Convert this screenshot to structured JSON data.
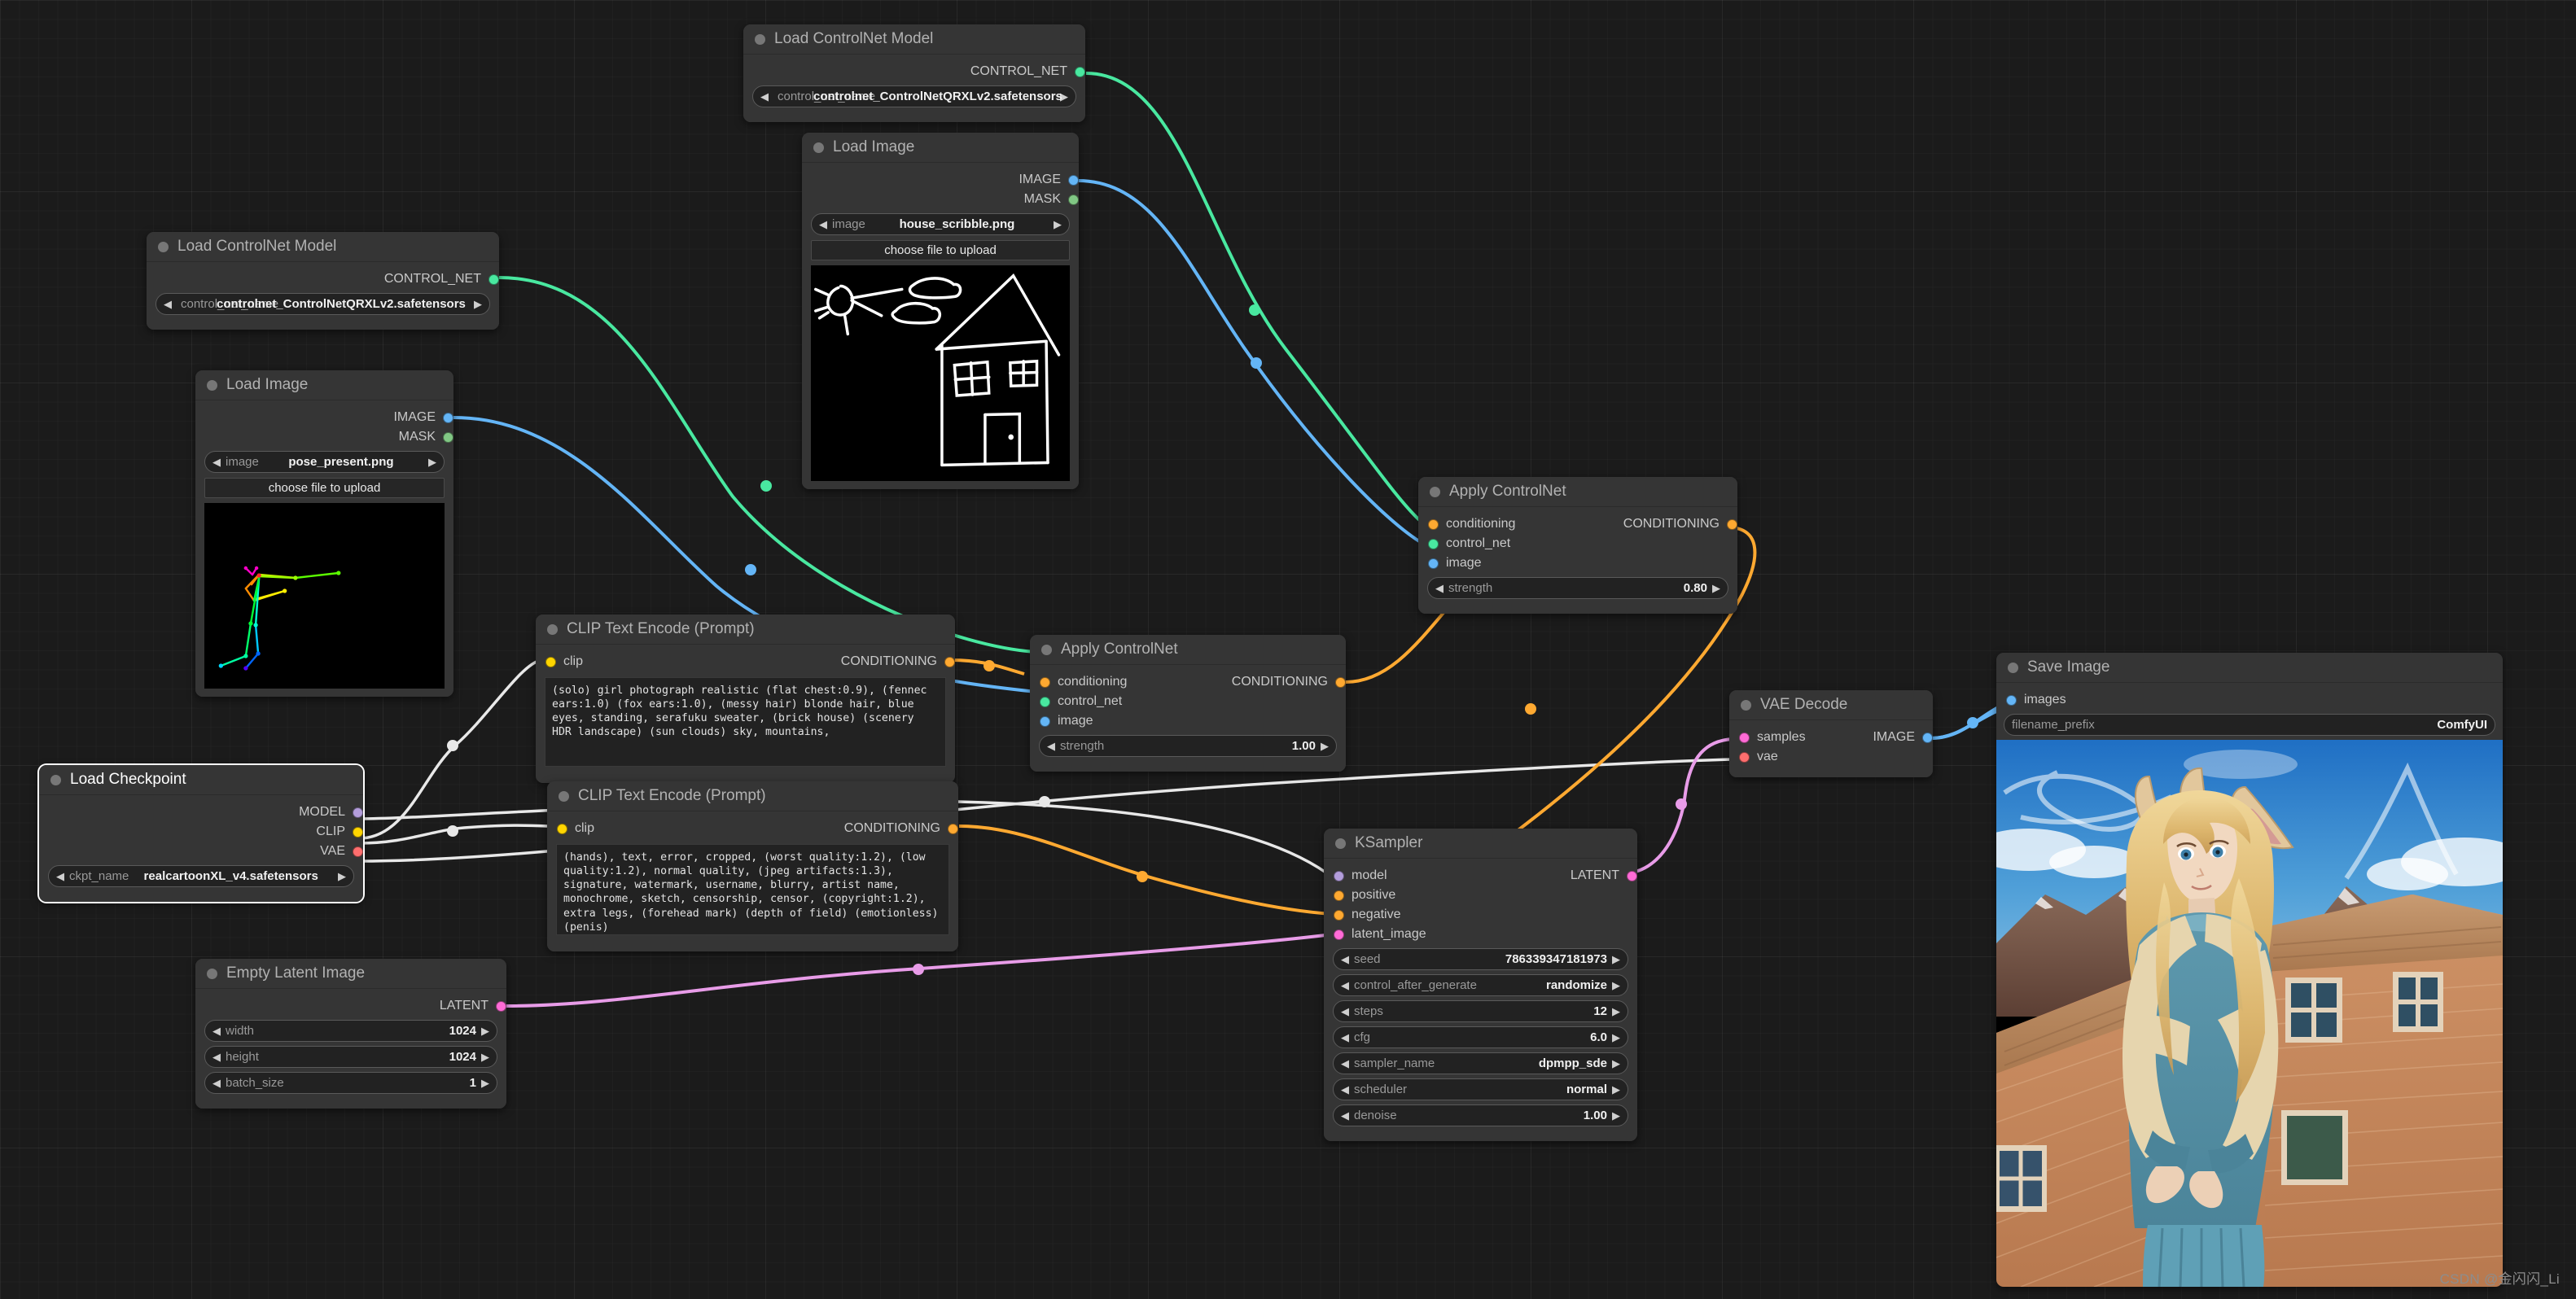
{
  "canvas": {
    "watermark": "CSDN @金闪闪_Li"
  },
  "nodes": {
    "load_controlnet_top": {
      "title": "Load ControlNet Model",
      "outputs": [
        {
          "label": "CONTROL_NET",
          "color": "#49e8a0"
        }
      ],
      "widget": {
        "label": "control_net_name",
        "value": "controlnet_ControlNetQRXLv2.safetensors",
        "arrow_left": "◀",
        "arrow_right": "▶"
      }
    },
    "load_image_top": {
      "title": "Load Image",
      "outputs": [
        {
          "label": "IMAGE",
          "color": "#64b5f6"
        },
        {
          "label": "MASK",
          "color": "#81c784"
        }
      ],
      "widget": {
        "label": "image",
        "value": "house_scribble.png",
        "arrow_left": "◀",
        "arrow_right": "▶"
      },
      "upload_button": "choose file to upload",
      "preview_alt": "house scribble line drawing: sun, two clouds, house with pitched roof, two windows and a door"
    },
    "load_controlnet_left": {
      "title": "Load ControlNet Model",
      "outputs": [
        {
          "label": "CONTROL_NET",
          "color": "#49e8a0"
        }
      ],
      "widget": {
        "label": "control_net_name",
        "value": "controlnet_ControlNetQRXLv2.safetensors",
        "arrow_left": "◀",
        "arrow_right": "▶"
      }
    },
    "load_image_left": {
      "title": "Load Image",
      "outputs": [
        {
          "label": "IMAGE",
          "color": "#64b5f6"
        },
        {
          "label": "MASK",
          "color": "#81c784"
        }
      ],
      "widget": {
        "label": "image",
        "value": "pose_present.png",
        "arrow_left": "◀",
        "arrow_right": "▶"
      },
      "upload_button": "choose file to upload",
      "preview_alt": "OpenPose skeleton of a standing figure on black background"
    },
    "clip_positive": {
      "title": "CLIP Text Encode (Prompt)",
      "inputs": [
        {
          "label": "clip",
          "color": "#ffd500"
        }
      ],
      "outputs": [
        {
          "label": "CONDITIONING",
          "color": "#ffa931"
        }
      ],
      "text": "(solo) girl photograph realistic (flat chest:0.9), (fennec ears:1.0) (fox ears:1.0), (messy hair) blonde hair, blue eyes, standing, serafuku sweater, (brick house) (scenery HDR landscape) (sun clouds) sky, mountains,"
    },
    "clip_negative": {
      "title": "CLIP Text Encode (Prompt)",
      "inputs": [
        {
          "label": "clip",
          "color": "#ffd500"
        }
      ],
      "outputs": [
        {
          "label": "CONDITIONING",
          "color": "#ffa931"
        }
      ],
      "text": "(hands), text, error, cropped, (worst quality:1.2), (low quality:1.2), normal quality, (jpeg artifacts:1.3), signature, watermark, username, blurry, artist name, monochrome, sketch, censorship, censor, (copyright:1.2), extra legs, (forehead mark) (depth of field) (emotionless) (penis)"
    },
    "apply_controlnet_1": {
      "title": "Apply ControlNet",
      "inputs": [
        {
          "label": "conditioning",
          "color": "#ffa931"
        },
        {
          "label": "control_net",
          "color": "#49e8a0"
        },
        {
          "label": "image",
          "color": "#64b5f6"
        }
      ],
      "outputs": [
        {
          "label": "CONDITIONING",
          "color": "#ffa931"
        }
      ],
      "widget": {
        "label": "strength",
        "value": "1.00",
        "arrow_left": "◀",
        "arrow_right": "▶"
      }
    },
    "apply_controlnet_2": {
      "title": "Apply ControlNet",
      "inputs": [
        {
          "label": "conditioning",
          "color": "#ffa931"
        },
        {
          "label": "control_net",
          "color": "#49e8a0"
        },
        {
          "label": "image",
          "color": "#64b5f6"
        }
      ],
      "outputs": [
        {
          "label": "CONDITIONING",
          "color": "#ffa931"
        }
      ],
      "widget": {
        "label": "strength",
        "value": "0.80",
        "arrow_left": "◀",
        "arrow_right": "▶"
      }
    },
    "load_checkpoint": {
      "title": "Load Checkpoint",
      "selected": true,
      "outputs": [
        {
          "label": "MODEL",
          "color": "#b39ddb"
        },
        {
          "label": "CLIP",
          "color": "#ffd500"
        },
        {
          "label": "VAE",
          "color": "#ff6e6e"
        }
      ],
      "widget": {
        "label": "ckpt_name",
        "value": "realcartoonXL_v4.safetensors",
        "arrow_left": "◀",
        "arrow_right": "▶"
      }
    },
    "empty_latent": {
      "title": "Empty Latent Image",
      "outputs": [
        {
          "label": "LATENT",
          "color": "#ff6bd6"
        }
      ],
      "widgets": [
        {
          "label": "width",
          "value": "1024",
          "arrow_left": "◀",
          "arrow_right": "▶"
        },
        {
          "label": "height",
          "value": "1024",
          "arrow_left": "◀",
          "arrow_right": "▶"
        },
        {
          "label": "batch_size",
          "value": "1",
          "arrow_left": "◀",
          "arrow_right": "▶"
        }
      ]
    },
    "ksampler": {
      "title": "KSampler",
      "inputs": [
        {
          "label": "model",
          "color": "#b39ddb"
        },
        {
          "label": "positive",
          "color": "#ffa931"
        },
        {
          "label": "negative",
          "color": "#ffa931"
        },
        {
          "label": "latent_image",
          "color": "#ff6bd6"
        }
      ],
      "outputs": [
        {
          "label": "LATENT",
          "color": "#ff6bd6"
        }
      ],
      "widgets": [
        {
          "label": "seed",
          "value": "786339347181973",
          "arrow_left": "◀",
          "arrow_right": "▶"
        },
        {
          "label": "control_after_generate",
          "value": "randomize",
          "arrow_left": "◀",
          "arrow_right": "▶"
        },
        {
          "label": "steps",
          "value": "12",
          "arrow_left": "◀",
          "arrow_right": "▶"
        },
        {
          "label": "cfg",
          "value": "6.0",
          "arrow_left": "◀",
          "arrow_right": "▶"
        },
        {
          "label": "sampler_name",
          "value": "dpmpp_sde",
          "arrow_left": "◀",
          "arrow_right": "▶"
        },
        {
          "label": "scheduler",
          "value": "normal",
          "arrow_left": "◀",
          "arrow_right": "▶"
        },
        {
          "label": "denoise",
          "value": "1.00",
          "arrow_left": "◀",
          "arrow_right": "▶"
        }
      ]
    },
    "vae_decode": {
      "title": "VAE Decode",
      "inputs": [
        {
          "label": "samples",
          "color": "#ff6bd6"
        },
        {
          "label": "vae",
          "color": "#ff6e6e"
        }
      ],
      "outputs": [
        {
          "label": "IMAGE",
          "color": "#64b5f6"
        }
      ]
    },
    "save_image": {
      "title": "Save Image",
      "inputs": [
        {
          "label": "images",
          "color": "#64b5f6"
        }
      ],
      "widget": {
        "label": "filename_prefix",
        "value": "ComfyUI"
      },
      "preview_alt": "generated image: blonde fox-eared girl in a blue and cream sweater standing in front of a brick house with mountains and blue sky"
    }
  }
}
